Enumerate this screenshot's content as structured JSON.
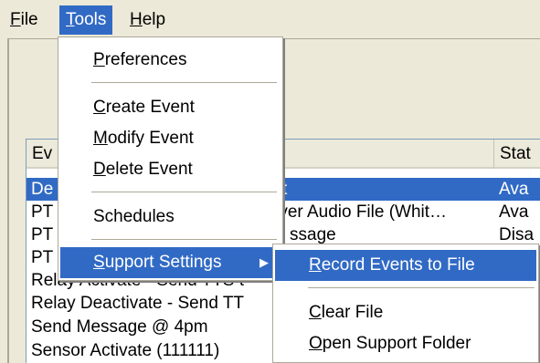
{
  "menubar": {
    "items": [
      {
        "label": "File"
      },
      {
        "label": "Tools"
      },
      {
        "label": "Help"
      }
    ]
  },
  "listview": {
    "columns": [
      "Ev",
      "Stat"
    ],
    "rows": [
      {
        "col1": "De",
        "col1_tail": "t",
        "status": "Ava",
        "selected": true
      },
      {
        "col1": "PT",
        "col1_tail": "rver Audio File (Whit…",
        "status": "Ava"
      },
      {
        "col1": "PT",
        "col1_tail": "ssage",
        "status": "Disa"
      },
      {
        "col1": "PT",
        "col1_tail": "",
        "status": ""
      },
      {
        "col1": "Relay Activate - Send TTS t",
        "col1_tail": "",
        "status": ""
      },
      {
        "col1": "Relay Deactivate - Send TT",
        "col1_tail": "",
        "status": ""
      },
      {
        "col1": "Send Message @ 4pm",
        "col1_tail": "",
        "status": ""
      },
      {
        "col1": "Sensor Activate (111111)",
        "col1_tail": "",
        "status": ""
      }
    ]
  },
  "tools_menu": {
    "items": [
      {
        "label": "Preferences",
        "ul": "P"
      },
      {
        "label": "Create Event",
        "ul": "C"
      },
      {
        "label": "Modify Event",
        "ul": "M"
      },
      {
        "label": "Delete Event",
        "ul": "D"
      },
      {
        "label": "Schedules"
      },
      {
        "label": "Support Settings",
        "ul": "S"
      }
    ],
    "submenu_arrow": "▶"
  },
  "support_submenu": {
    "items": [
      {
        "label": "Record Events to File",
        "ul": "R"
      },
      {
        "label": "Clear File",
        "ul": "C"
      },
      {
        "label": "Open Support Folder",
        "ul": "O"
      }
    ]
  },
  "colors": {
    "highlight": "#316ac5",
    "face": "#ece9d8"
  }
}
